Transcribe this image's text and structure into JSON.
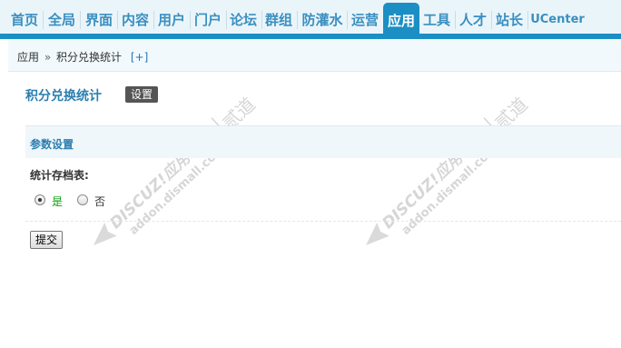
{
  "nav": {
    "items": [
      "首页",
      "全局",
      "界面",
      "内容",
      "用户",
      "门户",
      "论坛",
      "群组",
      "防灌水",
      "运营",
      "应用",
      "工具",
      "人才",
      "站长",
      "UCenter"
    ],
    "active": "应用"
  },
  "breadcrumb": {
    "root": "应用",
    "separator": "»",
    "current": "积分兑换统计",
    "plus": "[+]"
  },
  "page": {
    "title": "积分兑换统计",
    "tag": "设置"
  },
  "section": {
    "title": "参数设置",
    "field_label": "统计存档表:",
    "options": [
      "是",
      "否"
    ],
    "selected": "是"
  },
  "form": {
    "submit_label": "提交"
  },
  "watermark": {
    "line1": "DISCUZ!应用中心",
    "line2": "addon.dismall.com",
    "brand": "贰道"
  }
}
